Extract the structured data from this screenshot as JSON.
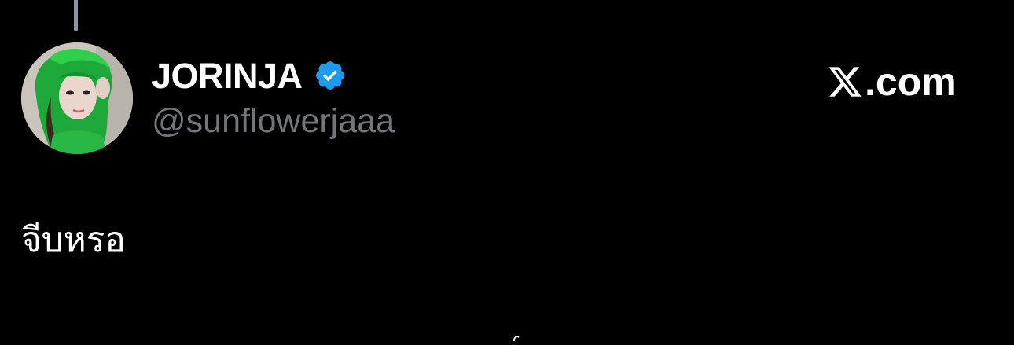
{
  "tweet": {
    "author": {
      "display_name": "JORINJA",
      "handle": "@sunflowerjaaa",
      "verified": true,
      "avatar_icon": "profile-avatar-photo"
    },
    "brand": {
      "logo_icon": "x-logo-icon",
      "domain_text": ".com"
    },
    "text": "จีบหรอ"
  },
  "colors": {
    "background": "#000000",
    "name": "#ffffff",
    "handle": "#71767b",
    "verified_badge": "#1d9bf0",
    "thread_line": "#8b98a5"
  }
}
